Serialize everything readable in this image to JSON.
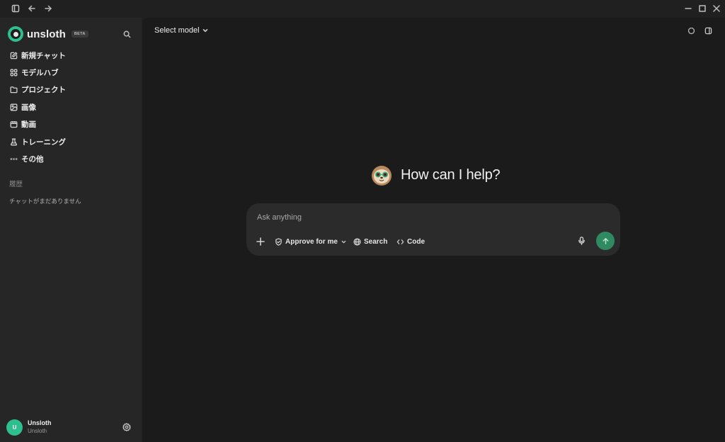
{
  "brand": {
    "name": "unsloth",
    "badge": "BETA"
  },
  "nav": {
    "items": [
      {
        "label": "新規チャット",
        "icon": "new-chat-icon"
      },
      {
        "label": "モデルハブ",
        "icon": "grid-icon"
      },
      {
        "label": "プロジェクト",
        "icon": "folder-icon"
      },
      {
        "label": "画像",
        "icon": "image-icon"
      },
      {
        "label": "動画",
        "icon": "video-icon"
      },
      {
        "label": "トレーニング",
        "icon": "flask-icon"
      },
      {
        "label": "その他",
        "icon": "more-icon"
      }
    ]
  },
  "history": {
    "title": "履歴",
    "empty": "チャットがまだありません"
  },
  "user": {
    "initial": "U",
    "name": "Unsloth",
    "subtitle": "Unsloth"
  },
  "header": {
    "model_select": "Select model"
  },
  "hero": {
    "title": "How can I help?"
  },
  "composer": {
    "placeholder": "Ask anything",
    "approve": "Approve for me",
    "search": "Search",
    "code": "Code"
  },
  "colors": {
    "accent": "#2fbf8f",
    "send": "#2f8a62"
  }
}
